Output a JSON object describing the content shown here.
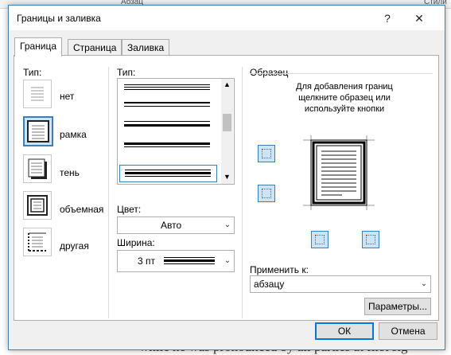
{
  "background": {
    "ribbon_labels": [
      "Абзац",
      "Стили"
    ],
    "text_lines": [
      "while he was pronounced by all parties at first sig"
    ]
  },
  "dialog": {
    "title": "Границы и заливка",
    "help_label": "?",
    "close_label": "✕",
    "tabs": [
      {
        "label": "Граница",
        "active": true
      },
      {
        "label": "Страница",
        "active": false
      },
      {
        "label": "Заливка",
        "active": false
      }
    ],
    "setting": {
      "label": "Тип:",
      "items": [
        {
          "label": "нет",
          "icon": "border-none-icon"
        },
        {
          "label": "рамка",
          "icon": "border-box-icon",
          "selected": true
        },
        {
          "label": "тень",
          "icon": "border-shadow-icon"
        },
        {
          "label": "объемная",
          "icon": "border-3d-icon"
        },
        {
          "label": "другая",
          "icon": "border-custom-icon"
        }
      ]
    },
    "style": {
      "label": "Тип:",
      "selected_index": 4
    },
    "color": {
      "label": "Цвет:",
      "value": "Авто"
    },
    "width": {
      "label": "Ширина:",
      "value": "3 пт"
    },
    "preview": {
      "label": "Образец",
      "hint": "Для добавления границ щелкните образец или используйте кнопки"
    },
    "apply_to": {
      "label": "Применить к:",
      "value": "абзацу"
    },
    "options_button": "Параметры...",
    "ok_button": "ОК",
    "cancel_button": "Отмена"
  }
}
